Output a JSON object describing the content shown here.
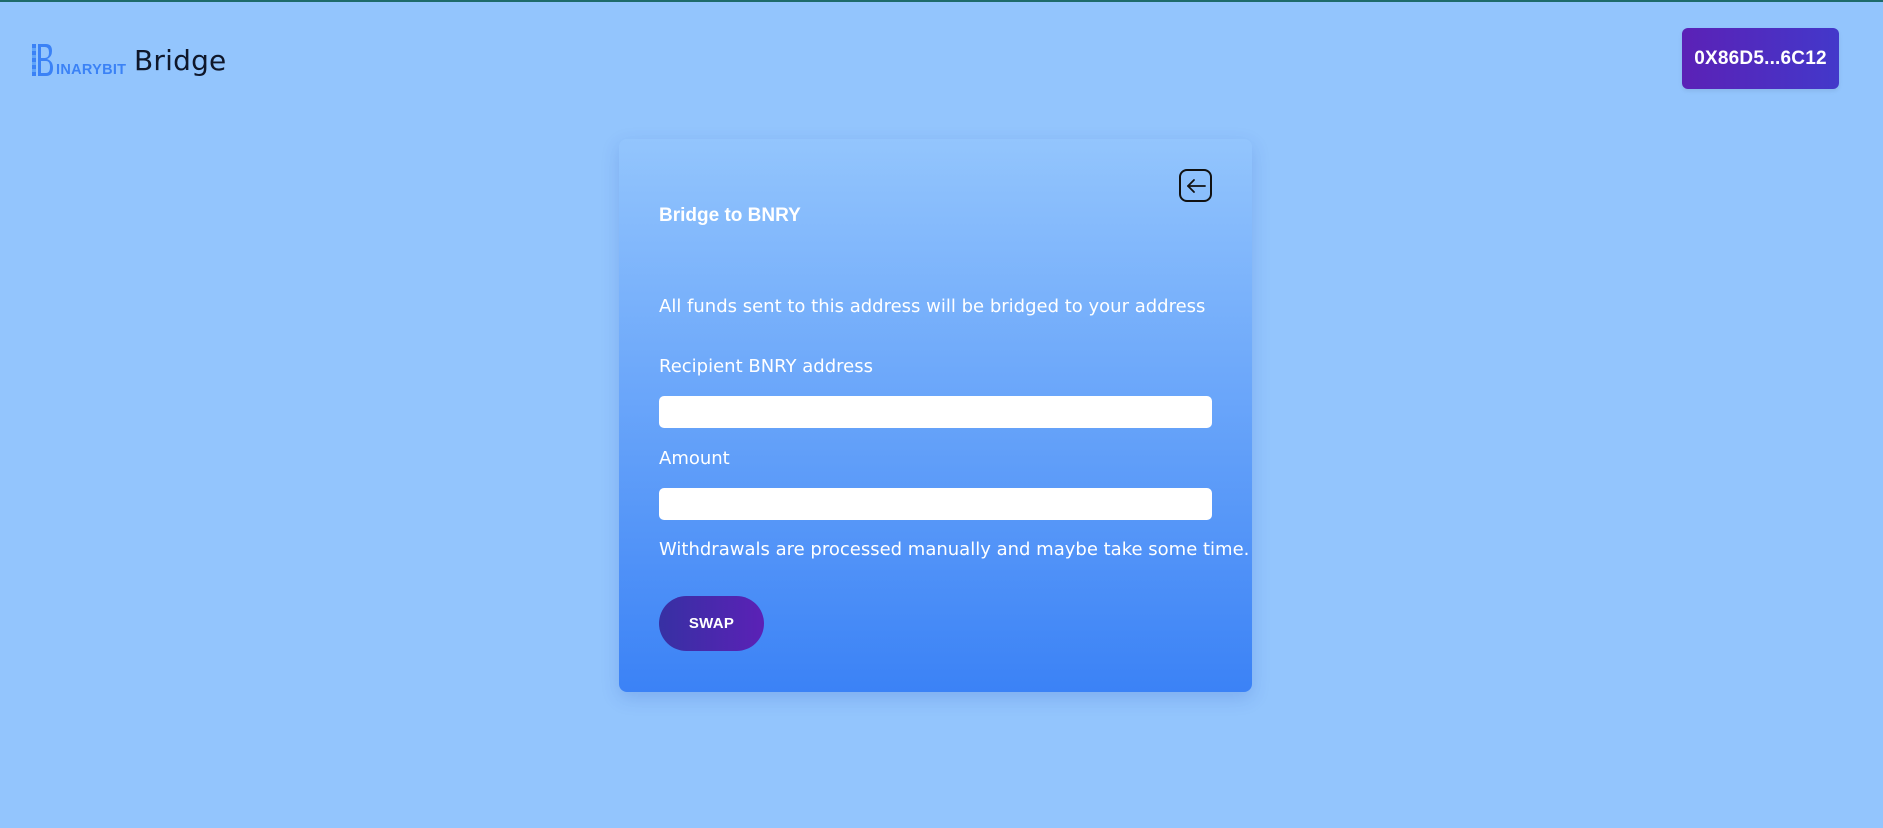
{
  "header": {
    "logo_text": "INARYBIT",
    "title": "Bridge",
    "wallet_label": "0X86D5...6C12"
  },
  "card": {
    "title": "Bridge to BNRY",
    "notice": "All funds sent to this address will be bridged to your address",
    "recipient_label": "Recipient BNRY address",
    "recipient_value": "",
    "amount_label": "Amount",
    "amount_value": "",
    "footnote": "Withdrawals are processed manually and maybe take some time.",
    "swap_label": "SWAP",
    "back_icon": "arrow-left-icon"
  },
  "colors": {
    "page_background": "#93c5fd",
    "card_gradient_top": "#93c5fd",
    "card_gradient_bottom": "#3b82f6",
    "button_purple": "#5b21b6",
    "button_indigo": "#4338ca",
    "logo_blue": "#3b82f6"
  }
}
